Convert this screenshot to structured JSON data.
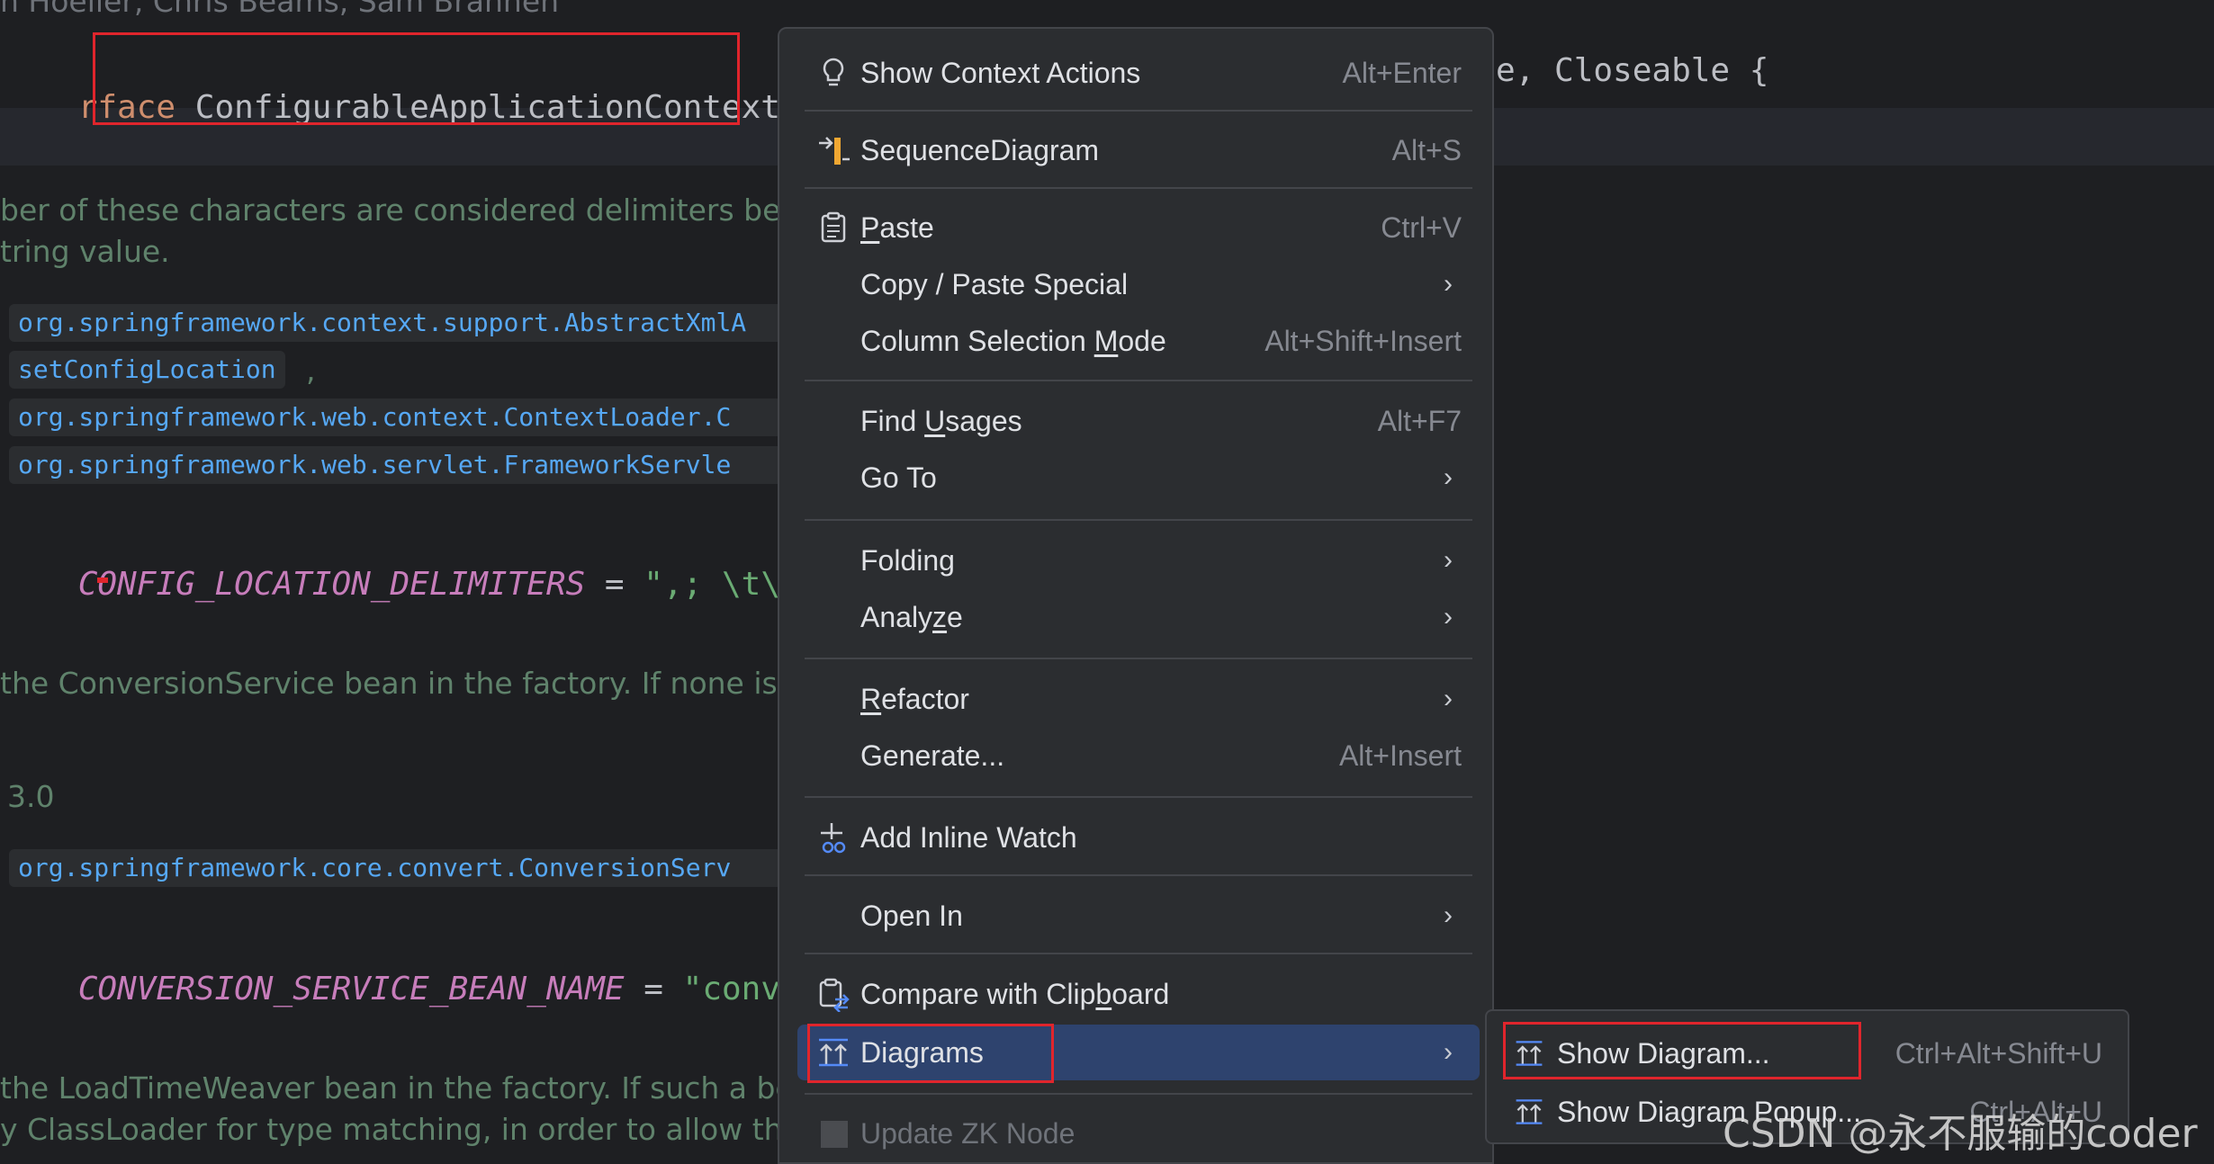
{
  "editor": {
    "top_authors": "n Hoeller, Chris Beams, Sam Brannen",
    "decl_keyword": "rface",
    "decl_name": "ConfigurableApplicationContext",
    "decl_ext": "ex",
    "decl_rest": "e, Closeable {",
    "doc1_line1": "ber of these characters are considered delimiters between",
    "doc1_line2": "tring value.",
    "links1": [
      "org.springframework.context.support.AbstractXmlA",
      "setConfigLocation",
      "org.springframework.web.context.ContextLoader.C",
      "org.springframework.web.servlet.FrameworkServle"
    ],
    "comma": ",",
    "const1_name": "CONFIG_LOCATION_DELIMITERS",
    "eq": "=",
    "const1_value": "\",; \\t\\n\"",
    "doc2_line1": "the ConversionService bean in the factory. If none is supp",
    "since_value": "3.0",
    "link2": "org.springframework.core.convert.ConversionServ",
    "const2_name": "CONVERSION_SERVICE_BEAN_NAME",
    "const2_value": "\"convers",
    "doc3_line1": "the LoadTimeWeaver bean in the factory. If such a bean i",
    "doc3_line2": "y ClassLoader for type matching, in order to allow the Loa"
  },
  "context_menu": {
    "show_context_actions": {
      "label": "Show Context Actions",
      "shortcut": "Alt+Enter",
      "icon": "lightbulb-icon"
    },
    "sequence_diagram": {
      "label": "SequenceDiagram",
      "shortcut": "Alt+S",
      "icon": "sequence-diagram-icon"
    },
    "paste": {
      "label_u": "P",
      "label_rest": "aste",
      "shortcut": "Ctrl+V",
      "icon": "clipboard-icon"
    },
    "copy_paste_special": {
      "label": "Copy / Paste Special"
    },
    "column_selection_mode": {
      "label_pre": "Column Selection ",
      "label_u": "M",
      "label_post": "ode",
      "shortcut": "Alt+Shift+Insert"
    },
    "find_usages": {
      "label_pre": "Find ",
      "label_u": "U",
      "label_post": "sages",
      "shortcut": "Alt+F7"
    },
    "go_to": {
      "label": "Go To"
    },
    "folding": {
      "label": "Folding"
    },
    "analyze": {
      "label_pre": "Analy",
      "label_u": "z",
      "label_post": "e"
    },
    "refactor": {
      "label_u": "R",
      "label_rest": "efactor"
    },
    "generate": {
      "label": "Generate...",
      "shortcut": "Alt+Insert"
    },
    "add_inline_watch": {
      "label": "Add Inline Watch",
      "icon": "inline-watch-icon"
    },
    "open_in": {
      "label": "Open In"
    },
    "compare_with_clipboard": {
      "label_pre": "Compare with Clip",
      "label_u": "b",
      "label_post": "oard",
      "icon": "compare-clipboard-icon"
    },
    "diagrams": {
      "label": "Diagrams",
      "icon": "diagram-icon"
    },
    "update_zk_node": {
      "label": "Update ZK Node"
    }
  },
  "submenu": {
    "show_diagram": {
      "label": "Show Diagram...",
      "shortcut": "Ctrl+Alt+Shift+U"
    },
    "show_diagram_popup": {
      "label": "Show Diagram Popup...",
      "shortcut": "Ctrl+Alt+U"
    }
  },
  "watermark": "CSDN @永不服输的coder",
  "colors": {
    "selection": "#2e436e",
    "annotation_red": "#e0252c",
    "menu_bg": "#2b2d30",
    "editor_bg": "#1e1f22"
  }
}
